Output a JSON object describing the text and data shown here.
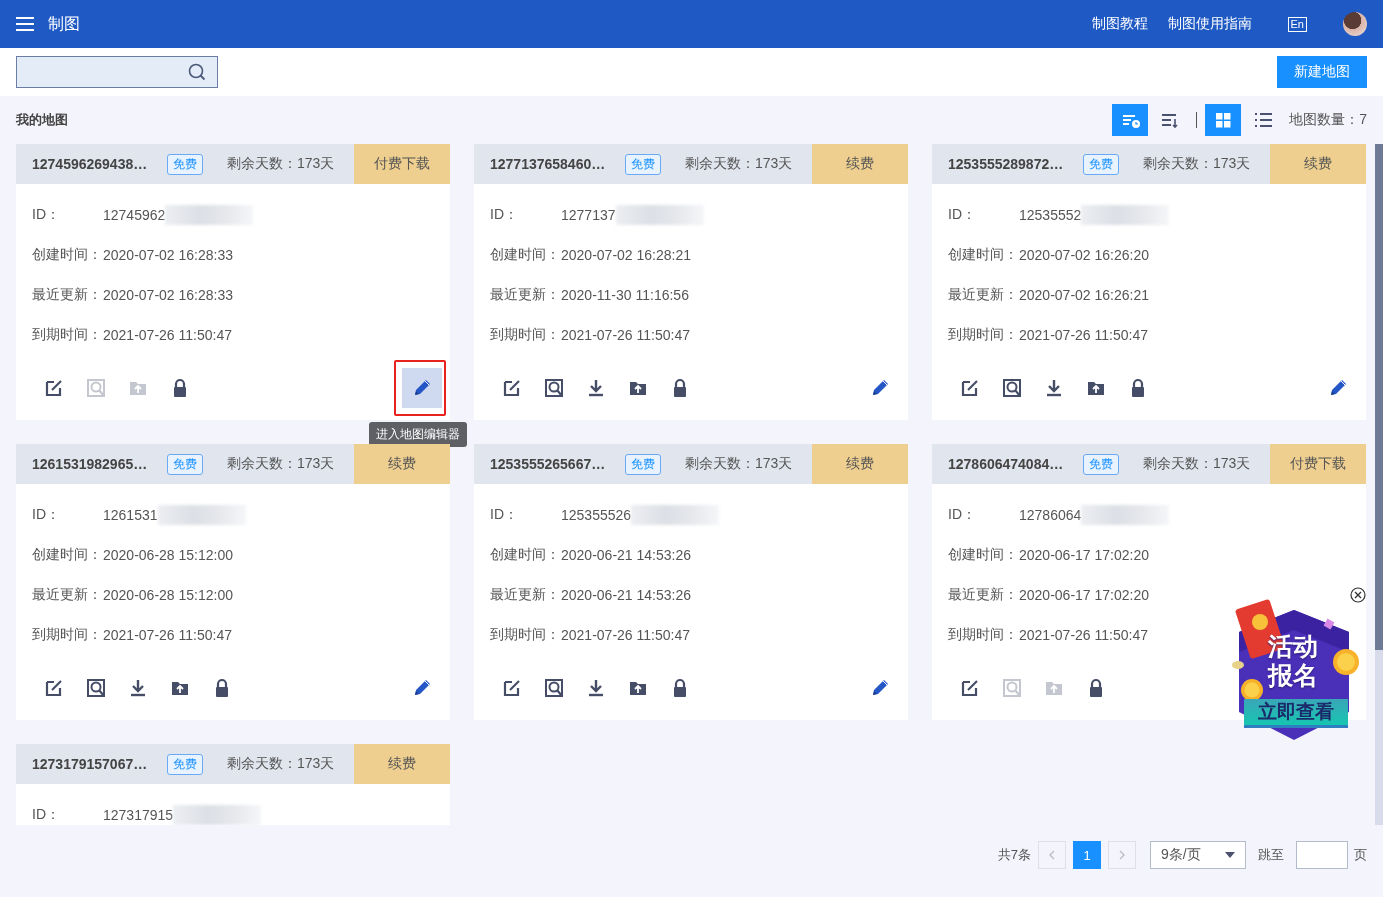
{
  "header": {
    "title": "制图",
    "links": [
      "制图教程",
      "制图使用指南"
    ],
    "language": "En"
  },
  "new_button": "新建地图",
  "section_title": "我的地图",
  "view_buttons": [
    {
      "kind": "time-sort",
      "selected": true
    },
    {
      "kind": "sort",
      "selected": false
    },
    {
      "kind": "grid",
      "selected": true
    },
    {
      "kind": "list",
      "selected": false
    }
  ],
  "map_count": "地图数量：7",
  "cards": [
    {
      "title": "1274596269438…",
      "badge": "免费",
      "remaining": "剩余天数：173天",
      "action": "付费下载",
      "id_label": "ID：",
      "id_value": "12745962",
      "fields": [
        {
          "label": "创建时间：",
          "value": "2020-07-02 16:28:33"
        },
        {
          "label": "最近更新：",
          "value": "2020-07-02 16:28:33"
        },
        {
          "label": "到期时间：",
          "value": "2021-07-26 11:50:47"
        }
      ],
      "tools": [
        {
          "kind": "edit",
          "disabled": false
        },
        {
          "kind": "preview",
          "disabled": true
        },
        {
          "kind": "upload",
          "disabled": true
        },
        {
          "kind": "lock",
          "disabled": false
        }
      ],
      "editor_highlighted": true,
      "tooltip": "进入地图编辑器"
    },
    {
      "title": "1277137658460…",
      "badge": "免费",
      "remaining": "剩余天数：173天",
      "action": "续费",
      "id_label": "ID：",
      "id_value": "1277137",
      "fields": [
        {
          "label": "创建时间：",
          "value": "2020-07-02 16:28:21"
        },
        {
          "label": "最近更新：",
          "value": "2020-11-30 11:16:56"
        },
        {
          "label": "到期时间：",
          "value": "2021-07-26 11:50:47"
        }
      ],
      "tools": [
        {
          "kind": "edit",
          "disabled": false
        },
        {
          "kind": "preview",
          "disabled": false
        },
        {
          "kind": "download",
          "disabled": false
        },
        {
          "kind": "upload",
          "disabled": false
        },
        {
          "kind": "lock",
          "disabled": false
        }
      ],
      "editor_highlighted": false
    },
    {
      "title": "1253555289872…",
      "badge": "免费",
      "remaining": "剩余天数：173天",
      "action": "续费",
      "id_label": "ID：",
      "id_value": "12535552",
      "fields": [
        {
          "label": "创建时间：",
          "value": "2020-07-02 16:26:20"
        },
        {
          "label": "最近更新：",
          "value": "2020-07-02 16:26:21"
        },
        {
          "label": "到期时间：",
          "value": "2021-07-26 11:50:47"
        }
      ],
      "tools": [
        {
          "kind": "edit",
          "disabled": false
        },
        {
          "kind": "preview",
          "disabled": false
        },
        {
          "kind": "download",
          "disabled": false
        },
        {
          "kind": "upload",
          "disabled": false
        },
        {
          "kind": "lock",
          "disabled": false
        }
      ],
      "editor_highlighted": false
    },
    {
      "title": "1261531982965…",
      "badge": "免费",
      "remaining": "剩余天数：173天",
      "action": "续费",
      "id_label": "ID：",
      "id_value": "1261531",
      "fields": [
        {
          "label": "创建时间：",
          "value": "2020-06-28 15:12:00"
        },
        {
          "label": "最近更新：",
          "value": "2020-06-28 15:12:00"
        },
        {
          "label": "到期时间：",
          "value": "2021-07-26 11:50:47"
        }
      ],
      "tools": [
        {
          "kind": "edit",
          "disabled": false
        },
        {
          "kind": "preview",
          "disabled": false
        },
        {
          "kind": "download",
          "disabled": false
        },
        {
          "kind": "upload",
          "disabled": false
        },
        {
          "kind": "lock",
          "disabled": false
        }
      ],
      "editor_highlighted": false
    },
    {
      "title": "1253555265667…",
      "badge": "免费",
      "remaining": "剩余天数：173天",
      "action": "续费",
      "id_label": "ID：",
      "id_value": "125355526",
      "fields": [
        {
          "label": "创建时间：",
          "value": "2020-06-21 14:53:26"
        },
        {
          "label": "最近更新：",
          "value": "2020-06-21 14:53:26"
        },
        {
          "label": "到期时间：",
          "value": "2021-07-26 11:50:47"
        }
      ],
      "tools": [
        {
          "kind": "edit",
          "disabled": false
        },
        {
          "kind": "preview",
          "disabled": false
        },
        {
          "kind": "download",
          "disabled": false
        },
        {
          "kind": "upload",
          "disabled": false
        },
        {
          "kind": "lock",
          "disabled": false
        }
      ],
      "editor_highlighted": false
    },
    {
      "title": "1278606474084…",
      "badge": "免费",
      "remaining": "剩余天数：173天",
      "action": "付费下载",
      "id_label": "ID：",
      "id_value": "12786064",
      "fields": [
        {
          "label": "创建时间：",
          "value": "2020-06-17 17:02:20"
        },
        {
          "label": "最近更新：",
          "value": "2020-06-17 17:02:20"
        },
        {
          "label": "到期时间：",
          "value": "2021-07-26 11:50:47"
        }
      ],
      "tools": [
        {
          "kind": "edit",
          "disabled": false
        },
        {
          "kind": "preview",
          "disabled": true
        },
        {
          "kind": "upload",
          "disabled": true
        },
        {
          "kind": "lock",
          "disabled": false
        }
      ]
    },
    {
      "title": "1273179157067…",
      "badge": "免费",
      "remaining": "剩余天数：173天",
      "action": "续费",
      "id_label": "ID：",
      "id_value": "127317915"
    }
  ],
  "promo": {
    "title": "活动报名",
    "button": "立即查看"
  },
  "pager": {
    "total": "共7条",
    "pages": [
      {
        "label": "1",
        "selected": true
      }
    ],
    "page_size": "9条/页",
    "jump_label": "跳至",
    "page_suffix": "页"
  }
}
